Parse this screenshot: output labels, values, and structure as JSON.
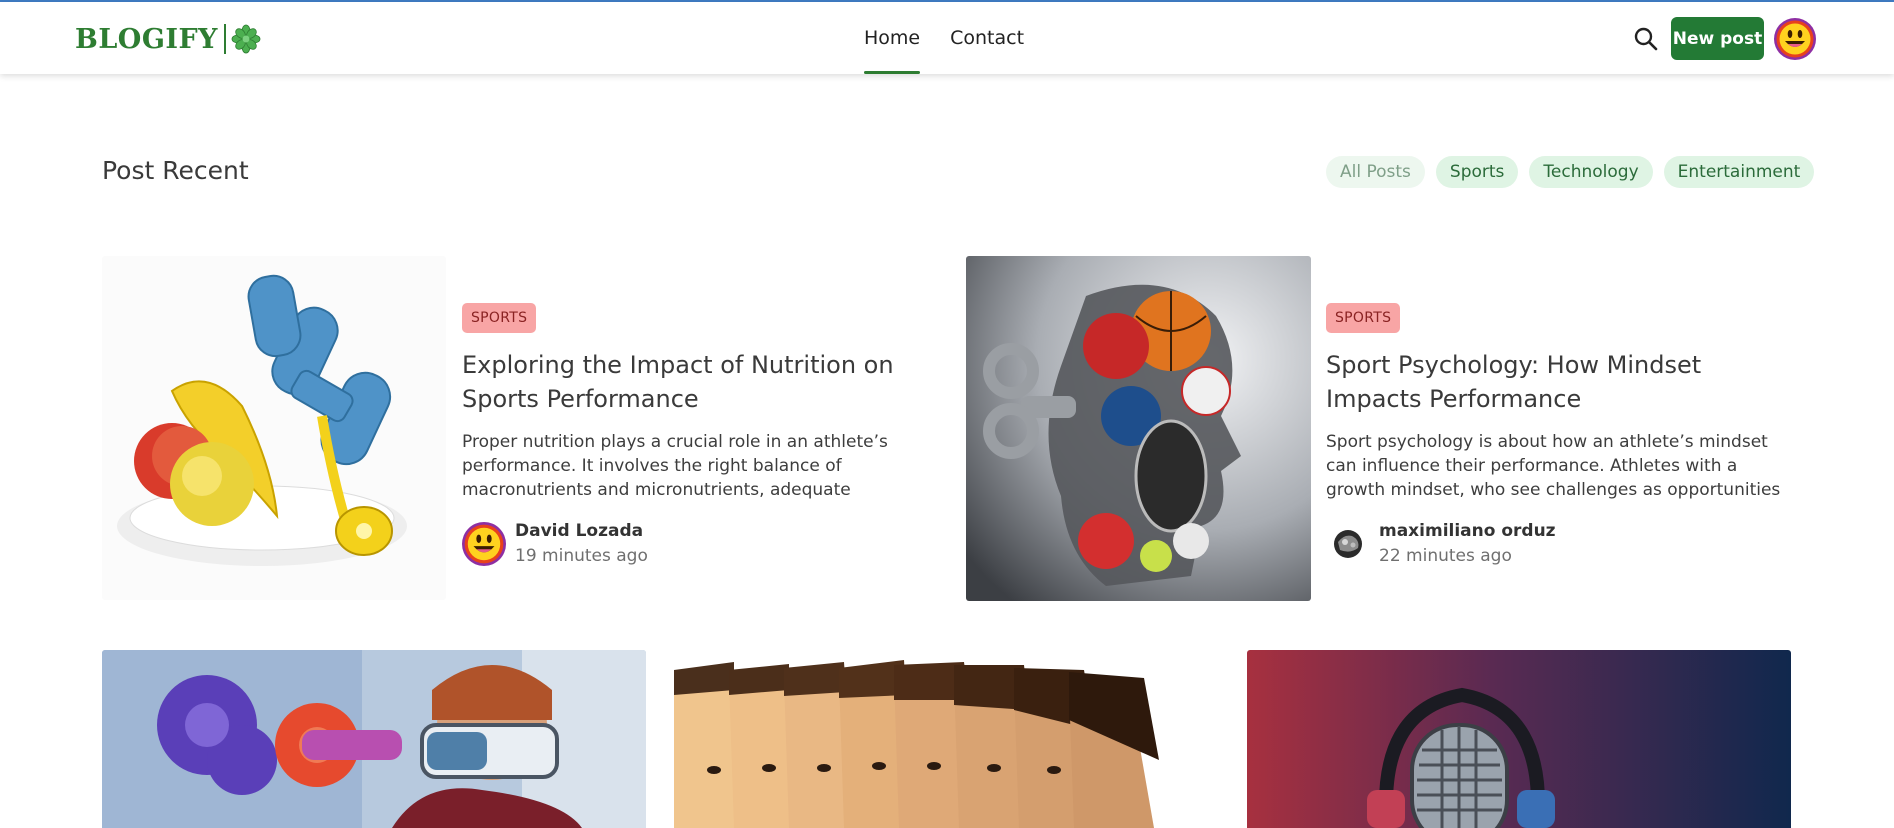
{
  "brand": {
    "name": "BLOGIFY"
  },
  "nav": {
    "links": [
      {
        "label": "Home",
        "active": true
      },
      {
        "label": "Contact",
        "active": false
      }
    ],
    "search_icon": "search-icon",
    "new_post_label": "New post",
    "avatar_icon": "grinning-face-avatar"
  },
  "colors": {
    "brand_green": "#237a35",
    "chip_bg": "#dff4e4",
    "badge_bg": "#f8a5a5",
    "top_border": "#3f7cc4"
  },
  "main": {
    "section_title": "Post Recent",
    "filters": [
      "All Posts",
      "Sports",
      "Technology",
      "Entertainment"
    ],
    "featured_posts": [
      {
        "category": "SPORTS",
        "title": "Exploring the Impact of Nutrition on Sports Performance",
        "excerpt": "Proper nutrition plays a crucial role in an athlete’s performance. It involves the right balance of macronutrients and micronutrients, adequate hydration…",
        "author": "David Lozada",
        "time": "19 minutes ago"
      },
      {
        "category": "SPORTS",
        "title": "Sport Psychology: How Mindset Impacts Performance",
        "excerpt": "Sport psychology is about how an athlete’s mindset can influence their performance. Athletes with a growth mindset, who see challenges as opportunities to learn,…",
        "author": "maximiliano orduz",
        "time": "22 minutes ago"
      }
    ]
  }
}
